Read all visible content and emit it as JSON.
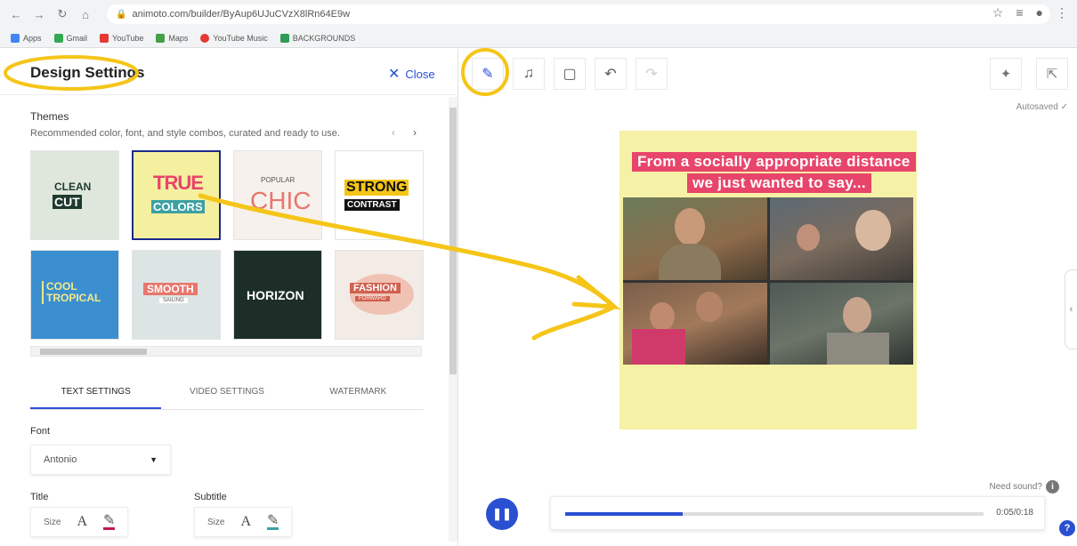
{
  "browser": {
    "url": "animoto.com/builder/ByAup6UJuCVzX8lRn64E9w",
    "bookmarks": [
      "Apps",
      "Gmail",
      "YouTube",
      "Maps",
      "YouTube Music",
      "BACKGROUNDS"
    ]
  },
  "panel": {
    "title": "Design Settings",
    "close_label": "Close",
    "themes_label": "Themes",
    "themes_desc": "Recommended color, font, and style combos, curated and ready to use.",
    "themes": [
      {
        "line1": "CLEAN",
        "line2": "CUT"
      },
      {
        "line1": "TRUE",
        "line2": "COLORS"
      },
      {
        "line1": "POPULAR",
        "line2": "CHIC"
      },
      {
        "line1": "STRONG",
        "line2": "CONTRAST"
      },
      {
        "line1": "COOL",
        "line2": "TROPICAL"
      },
      {
        "line1": "SMOOTH",
        "line2": "SAILING"
      },
      {
        "line1": "HORIZON",
        "line2": ""
      },
      {
        "line1": "FASHION",
        "line2": "FORWARD"
      }
    ],
    "tabs": [
      "TEXT SETTINGS",
      "VIDEO SETTINGS",
      "WATERMARK"
    ],
    "font_label": "Font",
    "font_value": "Antonio",
    "title_label": "Title",
    "subtitle_label": "Subtitle",
    "size_label": "Size"
  },
  "editor": {
    "autosaved": "Autosaved",
    "banner_line1": "From a socially appropriate distance",
    "banner_line2": "we just wanted to say...",
    "need_sound": "Need sound?",
    "time": "0:05/0:18",
    "progress": 0.28
  },
  "colors": {
    "accent": "#2a4fd1",
    "highlight": "#f5c518",
    "banner": "#e8456b",
    "canvas": "#f5f1a6"
  }
}
